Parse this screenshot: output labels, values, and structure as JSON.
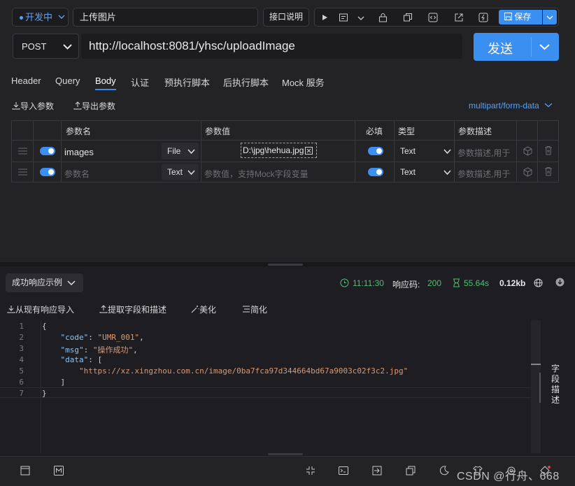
{
  "top": {
    "env_label": "开发中",
    "api_name": "上传图片",
    "doc_button": "接口说明",
    "save_label": "保存"
  },
  "request": {
    "method": "POST",
    "url": "http://localhost:8081/yhsc/uploadImage",
    "send_label": "发送"
  },
  "tabs": [
    "Header",
    "Query",
    "Body",
    "认证",
    "预执行脚本",
    "后执行脚本",
    "Mock 服务"
  ],
  "active_tab": "Body",
  "body": {
    "import_label": "导入参数",
    "export_label": "导出参数",
    "content_type": "multipart/form-data"
  },
  "table": {
    "headers": {
      "name": "参数名",
      "value": "参数值",
      "required": "必填",
      "type": "类型",
      "desc": "参数描述"
    },
    "rows": [
      {
        "name": "images",
        "kind": "File",
        "value": "D:\\jpg\\hehua.jpg",
        "type": "Text",
        "desc_placeholder": "参数描述,用于"
      },
      {
        "name_placeholder": "参数名",
        "kind": "Text",
        "value_placeholder": "参数值，支持Mock字段变量",
        "type": "Text",
        "desc_placeholder": "参数描述,用于"
      }
    ]
  },
  "response": {
    "example_label": "成功响应示例",
    "time": "11:11:30",
    "code_label": "响应码:",
    "code": "200",
    "duration": "55.64s",
    "size": "0.12kb",
    "import_label": "从现有响应导入",
    "extract_label": "提取字段和描述",
    "beautify_label": "美化",
    "simplify_label": "简化",
    "side_label": "字段描述"
  },
  "code_lines": [
    "{",
    "    \"code\": \"UMR_001\",",
    "    \"msg\": \"操作成功\",",
    "    \"data\": [",
    "        \"https://xz.xingzhou.com.cn/image/0ba7fca97d344664bd67a9003c02f3c2.jpg\"",
    "    ]",
    "}"
  ],
  "watermark": "CSDN @行舟、668",
  "colors": {
    "accent": "#3b8ff0",
    "success": "#4cc070"
  }
}
